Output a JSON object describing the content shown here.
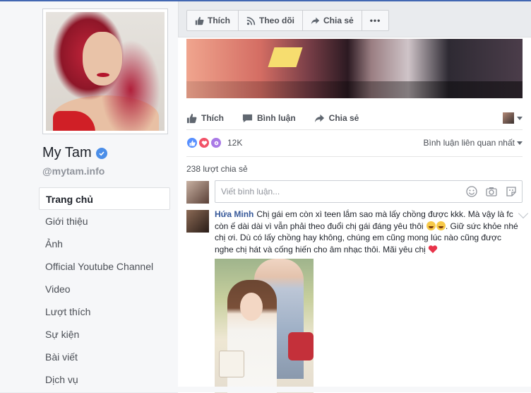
{
  "page": {
    "name": "My Tam",
    "handle": "@mytam.info",
    "verified": true
  },
  "nav": {
    "items": [
      {
        "label": "Trang chủ",
        "active": true
      },
      {
        "label": "Giới thiệu",
        "active": false
      },
      {
        "label": "Ảnh",
        "active": false
      },
      {
        "label": "Official Youtube Channel",
        "active": false
      },
      {
        "label": "Video",
        "active": false
      },
      {
        "label": "Lượt thích",
        "active": false
      },
      {
        "label": "Sự kiện",
        "active": false
      },
      {
        "label": "Bài viết",
        "active": false
      },
      {
        "label": "Dịch vụ",
        "active": false
      }
    ]
  },
  "page_actions": {
    "like": "Thích",
    "follow": "Theo dõi",
    "share": "Chia sẻ",
    "more": "•••"
  },
  "post": {
    "actions": {
      "like": "Thích",
      "comment": "Bình luận",
      "share": "Chia sẻ"
    },
    "reactions": {
      "count": "12K",
      "types": [
        "like",
        "love",
        "wow"
      ]
    },
    "sort_label": "Bình luận liên quan nhất",
    "shares_text": "238 lượt chia sẻ",
    "composer_placeholder": "Viết bình luận...",
    "comment": {
      "author": "Hứa Minh",
      "text_1": "Chị gái em còn xì teen lắm sao mà lấy chồng được kkk. Mà vậy là fc còn ế dài dài vì vẫn phải theo đuổi chị gái đáng yêu thôi",
      "text_2": ". Giữ sức khỏe nhé chị ơi. Dù có lấy chồng hay không, chúng em cũng mong lúc nào cũng được nghe chị hát và cống hiến cho âm nhạc thôi. Mãi yêu chị"
    }
  },
  "colors": {
    "link": "#365899",
    "accent": "#4267b2",
    "like": "#5890ff",
    "love": "#f25268",
    "wow": "#a97ae6"
  }
}
